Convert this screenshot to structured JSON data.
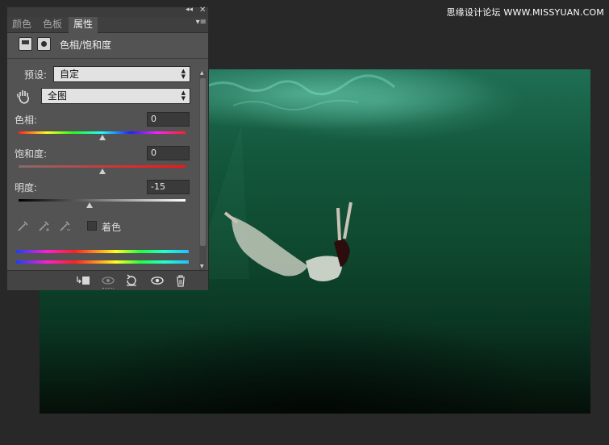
{
  "watermark": "思缘设计论坛 WWW.MISSYUAN.COM",
  "panel": {
    "collapse_icon": "double-chevron-icon",
    "close_icon": "close-icon",
    "tabs": [
      {
        "label": "颜色"
      },
      {
        "label": "色板"
      },
      {
        "label": "属性"
      }
    ],
    "menu_icon": "panel-menu-icon",
    "title": "色相/饱和度",
    "preset_label": "预设:",
    "preset_value": "自定",
    "channel_value": "全图",
    "hue_label": "色相:",
    "hue_value": "0",
    "saturation_label": "饱和度:",
    "saturation_value": "0",
    "lightness_label": "明度:",
    "lightness_value": "-15",
    "hue_pos": 0.5,
    "saturation_pos": 0.5,
    "lightness_pos": 0.425,
    "colorize_label": "着色",
    "colorize_checked": false,
    "footer_icons": [
      "clip-to-layer-icon",
      "view-previous-icon",
      "reset-icon",
      "visibility-eye-icon",
      "trash-icon"
    ]
  },
  "colors": {
    "panel_bg": "#535353",
    "app_bg": "#282828",
    "accent": "#e2e2e2"
  }
}
